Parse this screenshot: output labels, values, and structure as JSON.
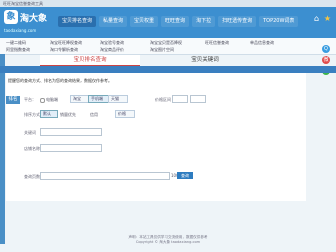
{
  "topbar": {
    "text": "旺旺淘宝信誉查询工具"
  },
  "logo": {
    "title": "淘大象",
    "subtitle": "taodaxiang.com",
    "mark": "象"
  },
  "nav": [
    "宝贝排名查询",
    "私量查询",
    "宝贝权重",
    "旺旺查询",
    "淘下拉",
    "扫旺透传查询",
    "TOP20W词表"
  ],
  "header_icons": {
    "home": "home-icon",
    "star": "star-icon"
  },
  "links": [
    "一键二维码",
    "淘宝旺旺降权查询",
    "淘宝验号查询",
    "淘宝宝贝是否降权",
    "旺旺信誉查询",
    "单品信息查询",
    "阿里指数查询",
    "淘口令解析查询",
    "淘宝商品评价",
    "淘宝图片空间"
  ],
  "social": [
    {
      "name": "qq-icon",
      "glyph": "Q",
      "color": "#3a9de0"
    },
    {
      "name": "weibo-icon",
      "glyph": "微",
      "color": "#e14b4b"
    },
    {
      "name": "wechat-icon",
      "glyph": "信",
      "color": "#3bb54a"
    }
  ],
  "tabs": {
    "tab1": "宝贝排名查询",
    "tab2": "宝贝关键词"
  },
  "notice": "提醒您的查询方式、排名为您的查询结果，数据仅作参考。",
  "sidetag": "排名",
  "form": {
    "platform_label": "平台：",
    "platform_options": [
      "电脑端",
      "淘宝",
      "手机端",
      "天猫"
    ],
    "range_label": "价格区间",
    "sort_label": "排序方式：",
    "sort_options": [
      "默认",
      "销量优先",
      "信用",
      "价格"
    ],
    "keyword_label": "关键词",
    "shop_label": "店铺名称",
    "page_label": "查询页数",
    "page_value": "100",
    "query_button": "查询"
  },
  "footer": {
    "line1": "声明：本站工具仅供学习交流使用，数据仅供参考",
    "line2": "Copyright © 淘大象 taodaxiang.com"
  },
  "bottom": {
    "text": "tao"
  }
}
